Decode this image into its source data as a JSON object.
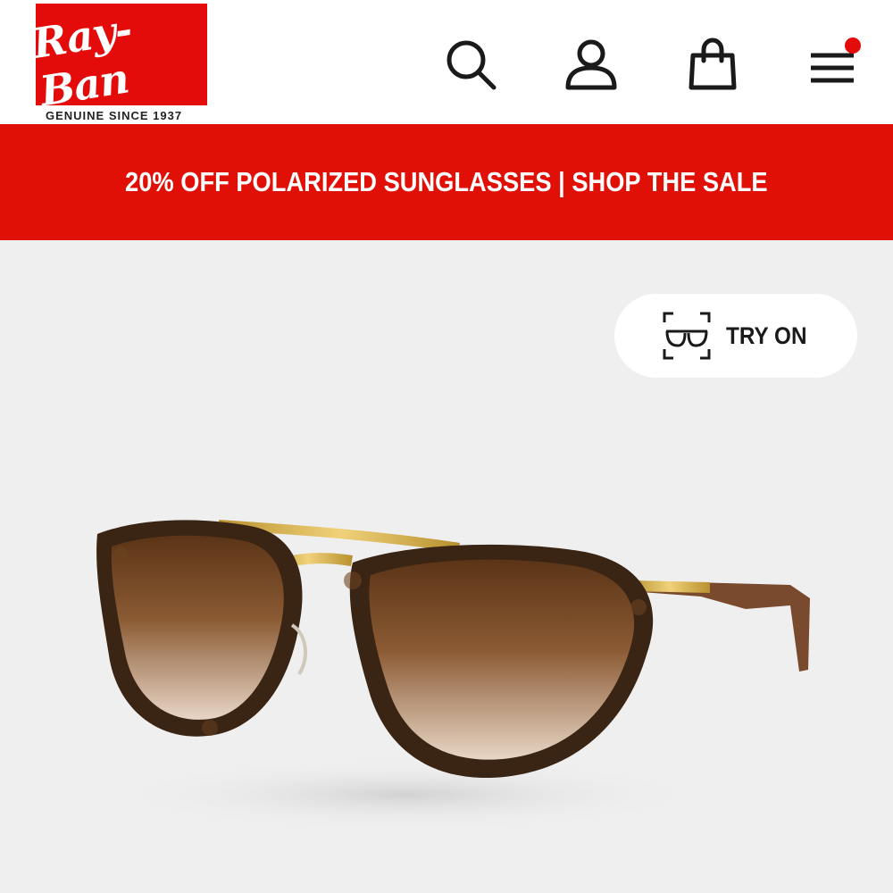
{
  "header": {
    "logo_text": "Ray-Ban",
    "tagline": "GENUINE SINCE 1937",
    "icons": [
      "search-icon",
      "user-icon",
      "shopping-bag-icon",
      "menu-icon"
    ],
    "menu_has_notification": true
  },
  "promo": {
    "text": "20% OFF POLARIZED SUNGLASSES | SHOP THE SALE"
  },
  "product": {
    "try_on_label": "TRY ON",
    "try_on_icon": "glasses-scan-icon",
    "image_subject": "sunglasses"
  },
  "colors": {
    "brand_red": "#e40b0b",
    "promo_red": "#e01006",
    "background": "#efefef"
  }
}
